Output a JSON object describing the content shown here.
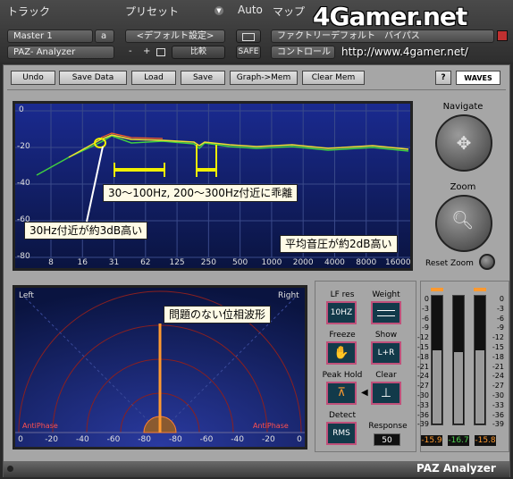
{
  "host": {
    "track_label": "トラック",
    "preset_label": "プリセット",
    "auto_label": "Auto",
    "map_label": "マップ",
    "track_name": "Master 1",
    "track_suffix": "a",
    "plugin_name": "PAZ- Analyzer",
    "preset_value": "<デフォルト設定>",
    "preset_minus": "-",
    "preset_plus": "+",
    "compare_label": "比較",
    "safe_label": "SAFE",
    "map_value": "ファクトリーデフォルト",
    "map_value2": "コントロール",
    "bypass_label": "バイパス",
    "watermark_logo": "4Gamer.net",
    "watermark_url": "http://www.4gamer.net/"
  },
  "toolbar": {
    "undo": "Undo",
    "save_data": "Save Data",
    "load": "Load",
    "save": "Save",
    "graph_mem": "Graph->Mem",
    "clear_mem": "Clear Mem",
    "help": "?",
    "brand": "WAVES"
  },
  "navigate": {
    "title": "Navigate",
    "zoom": "Zoom",
    "reset_zoom": "Reset Zoom"
  },
  "frequency_view": {
    "y_ticks": [
      "0",
      "-20",
      "-40",
      "-60",
      "-80"
    ],
    "x_ticks": [
      "8",
      "16",
      "31",
      "62",
      "125",
      "250",
      "500",
      "1000",
      "2000",
      "4000",
      "8000",
      "16000"
    ],
    "annotations": {
      "range": "30～100Hz, 200～300Hz付近に乖離",
      "low": "30Hz付近が約3dB高い",
      "avg": "平均音圧が約2dB高い"
    },
    "colors": {
      "line_a": "#f0e030",
      "line_b": "#40d040",
      "grid": "#3a4a8a"
    }
  },
  "phase_view": {
    "left": "Left",
    "right": "Right",
    "anti_left": "AntiPhase",
    "anti_right": "AntiPhase",
    "x_ticks": [
      "0",
      "-20",
      "-40",
      "-60",
      "-80",
      "-80",
      "-60",
      "-40",
      "-20",
      "0"
    ],
    "annotation": "問題のない位相波形"
  },
  "controls": {
    "lf_res_label": "LF res",
    "lf_res_value": "10HZ",
    "weight_label": "Weight",
    "freeze_label": "Freeze",
    "show_label": "Show",
    "show_value": "L+R",
    "peak_hold_label": "Peak Hold",
    "clear_label": "Clear",
    "detect_label": "Detect",
    "detect_value": "RMS",
    "response_label": "Response",
    "response_value": "50"
  },
  "meters": {
    "ticks": [
      "0",
      "-3",
      "-6",
      "-9",
      "-12",
      "-15",
      "-18",
      "-21",
      "-24",
      "-27",
      "-30",
      "-33",
      "-36",
      "-39"
    ],
    "left_value": "-15.9",
    "mid_value": "-16.7",
    "right_value": "-15.8",
    "left_level": 0.58,
    "mid_level": 0.56,
    "right_level": 0.58
  },
  "footer": {
    "title": "PAZ Analyzer"
  }
}
